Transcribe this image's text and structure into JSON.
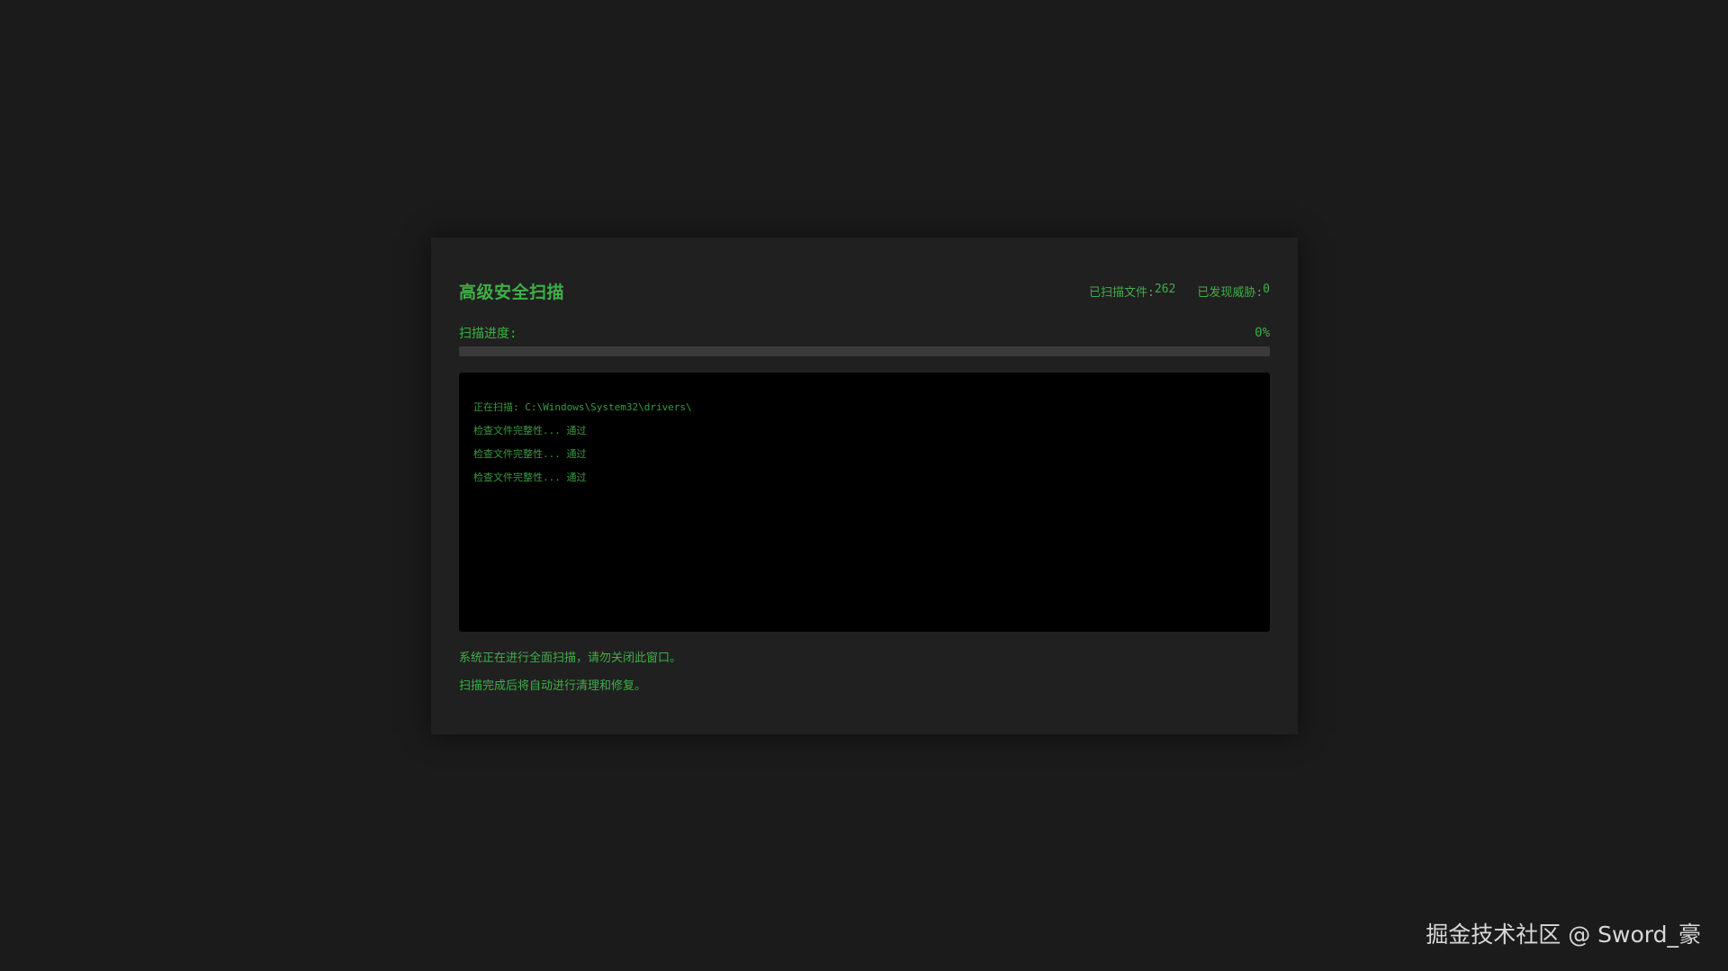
{
  "scanner": {
    "title": "高级安全扫描",
    "stats": {
      "files_label": "已扫描文件: ",
      "files_value": "262",
      "threats_label": "已发现威胁: ",
      "threats_value": "0"
    },
    "progress": {
      "label": "扫描进度:",
      "percent_text": "0%",
      "value": 0
    },
    "log": [
      "正在扫描: C:\\Windows\\System32\\drivers\\",
      "检查文件完整性... 通过",
      "检查文件完整性... 通过",
      "检查文件完整性... 通过"
    ],
    "notices": [
      "系统正在进行全面扫描，请勿关闭此窗口。",
      "扫描完成后将自动进行清理和修复。"
    ]
  },
  "watermark": "掘金技术社区 @ Sword_豪",
  "colors": {
    "accent": "#3fae48",
    "background": "#1b1b1b",
    "panel": "#202020",
    "terminal": "#000000",
    "track": "#3a3a3a"
  }
}
